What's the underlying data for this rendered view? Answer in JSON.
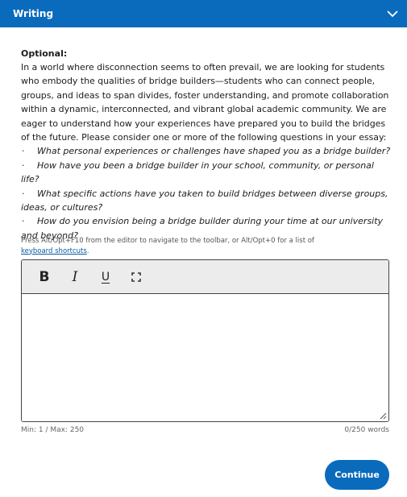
{
  "header": {
    "title": "Writing",
    "toggle_icon": "chevron-down-icon"
  },
  "prompt": {
    "label": "Optional:",
    "body": "In a world where disconnection seems to often prevail, we are looking for students who embody the qualities of bridge builders—students who can connect people, groups, and ideas to span divides, foster understanding, and promote collaboration within a dynamic, interconnected, and vibrant global academic community. We are eager to understand how your experiences have prepared you to build the bridges of the future. Please consider one or more of the following questions in your essay:",
    "bullet": "·",
    "questions": [
      "What personal experiences or challenges have shaped you as a bridge builder?",
      "How have you been a bridge builder in your school, community, or personal life?",
      "What specific actions have you taken to build bridges between diverse groups, ideas, or cultures?",
      "How do you envision being a bridge builder during your time at our university and beyond?"
    ]
  },
  "editor": {
    "hint_text": "Press Alt/Opt+F10 from the editor to navigate to the toolbar, or Alt/Opt+0 for a list of ",
    "hint_link": "keyboard shortcuts",
    "hint_end": ".",
    "toolbar": {
      "bold": "B",
      "italic": "I",
      "underline": "U",
      "fullscreen_icon": "expand-icon"
    },
    "value": "",
    "placeholder": ""
  },
  "footer": {
    "limits": "Min: 1 / Max: 250",
    "word_count": "0/250 words"
  },
  "actions": {
    "continue_label": "Continue"
  },
  "colors": {
    "brand": "#0a6bbd",
    "toolbar_bg": "#ececec"
  }
}
